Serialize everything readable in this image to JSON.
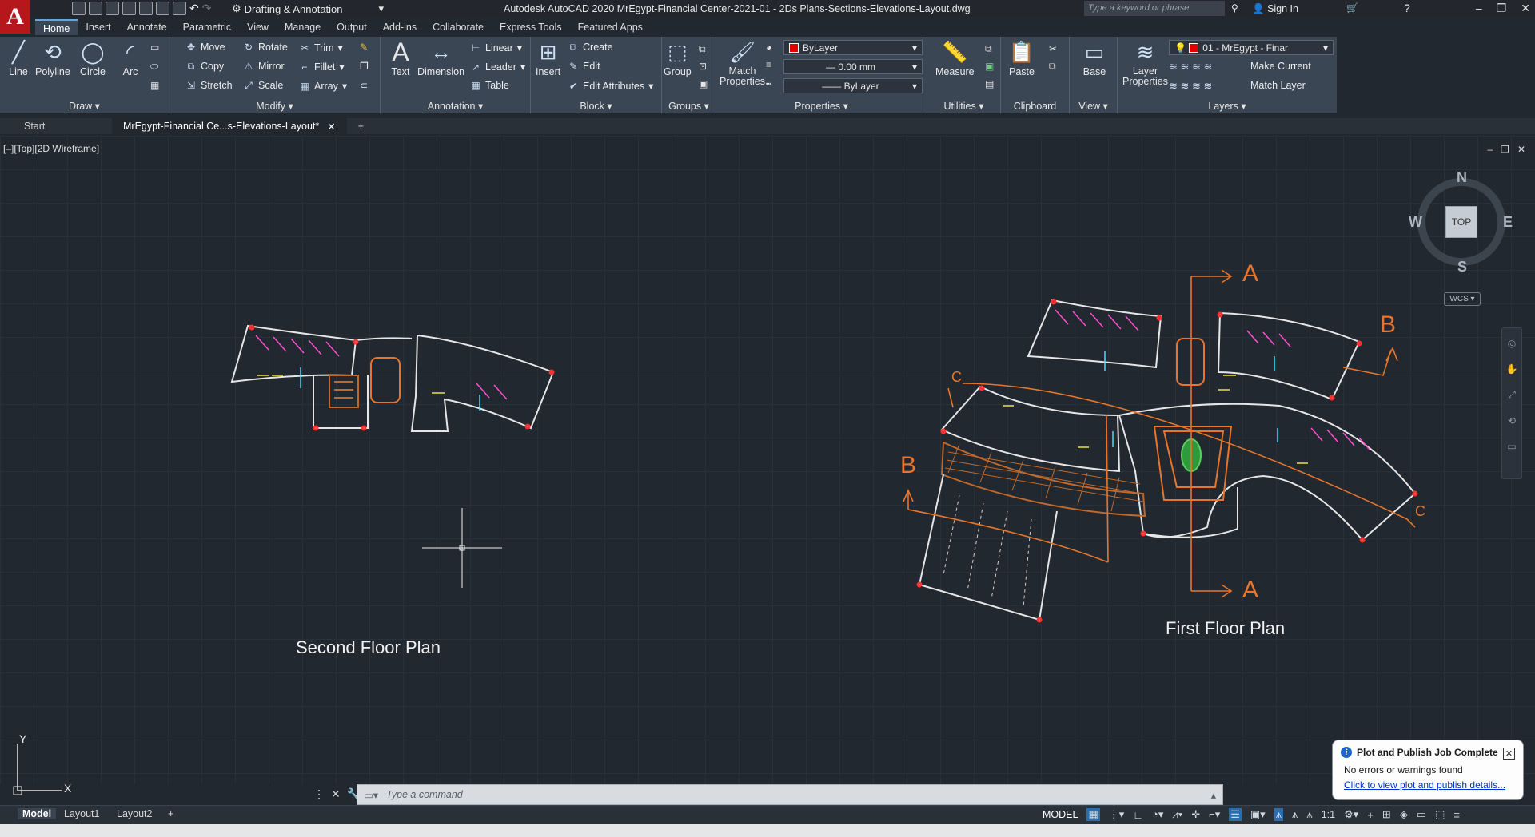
{
  "app": {
    "logo": "A",
    "title": "Autodesk AutoCAD 2020   MrEgypt-Financial Center-2021-01 - 2Ds Plans-Sections-Elevations-Layout.dwg",
    "workspace": "Drafting & Annotation",
    "search_placeholder": "Type a keyword or phrase",
    "signin": "Sign In",
    "window_controls": [
      "–",
      "❐",
      "✕"
    ]
  },
  "menu_tabs": [
    "Home",
    "Insert",
    "Annotate",
    "Parametric",
    "View",
    "Manage",
    "Output",
    "Add-ins",
    "Collaborate",
    "Express Tools",
    "Featured Apps"
  ],
  "ribbon": {
    "draw": {
      "title": "Draw",
      "line": "Line",
      "polyline": "Polyline",
      "circle": "Circle",
      "arc": "Arc"
    },
    "modify": {
      "title": "Modify",
      "move": "Move",
      "rotate": "Rotate",
      "trim": "Trim",
      "copy": "Copy",
      "mirror": "Mirror",
      "fillet": "Fillet",
      "stretch": "Stretch",
      "scale": "Scale",
      "array": "Array"
    },
    "annotation": {
      "title": "Annotation",
      "text": "Text",
      "dimension": "Dimension",
      "linear": "Linear",
      "leader": "Leader",
      "table": "Table"
    },
    "block": {
      "title": "Block",
      "insert": "Insert",
      "create": "Create",
      "edit": "Edit",
      "edit_attributes": "Edit Attributes"
    },
    "groups": {
      "title": "Groups",
      "group": "Group"
    },
    "properties": {
      "title": "Properties",
      "match": "Match\nProperties",
      "color": "ByLayer",
      "lineweight": "0.00 mm",
      "linetype": "ByLayer"
    },
    "utilities": {
      "title": "Utilities",
      "measure": "Measure"
    },
    "clipboard": {
      "title": "Clipboard",
      "paste": "Paste"
    },
    "view": {
      "title": "View",
      "base": "Base"
    },
    "layers": {
      "title": "Layers",
      "layer_properties": "Layer\nProperties",
      "current_layer": "01 - MrEgypt - Finar",
      "make_current": "Make Current",
      "match_layer": "Match Layer"
    }
  },
  "doc_tabs": {
    "start": "Start",
    "active": "MrEgypt-Financial Ce...s-Elevations-Layout*",
    "add": "+"
  },
  "viewport": {
    "label": "[–][Top][2D Wireframe]",
    "second_floor_label": "Second Floor Plan",
    "first_floor_label": "First Floor Plan",
    "section_marks": [
      "A",
      "A",
      "B",
      "B",
      "C",
      "C"
    ]
  },
  "viewcube": {
    "n": "N",
    "s": "S",
    "e": "E",
    "w": "W",
    "face": "TOP",
    "wcs": "WCS"
  },
  "command_line": {
    "placeholder": "Type a command"
  },
  "notification": {
    "title": "Plot and Publish Job Complete",
    "body": "No errors or warnings found",
    "link": "Click to view plot and publish details..."
  },
  "status": {
    "layout_tabs": [
      "Model",
      "Layout1",
      "Layout2"
    ],
    "model_label": "MODEL",
    "scale": "1:1"
  }
}
